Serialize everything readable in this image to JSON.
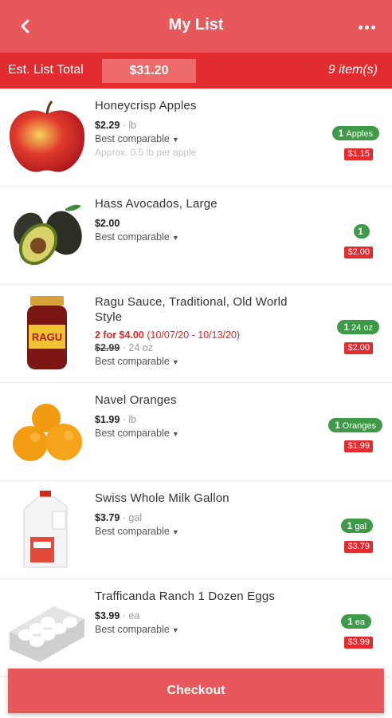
{
  "header": {
    "title": "My List"
  },
  "summary": {
    "label": "Est. List Total",
    "total": "$31.20",
    "count": "9 item(s)"
  },
  "items": [
    {
      "name": "Honeycrisp Apples",
      "price": "$2.29",
      "unit": "lb",
      "comparable": "Best comparable",
      "approx": "Approx. 0.5 lb per apple",
      "qty": "1",
      "qty_unit": "Apples",
      "line_total": "$1.15"
    },
    {
      "name": "Hass Avocados, Large",
      "price": "$2.00",
      "comparable": "Best comparable",
      "qty": "1",
      "line_total": "$2.00"
    },
    {
      "name_line1": "Ragu Sauce, Traditional, Old World",
      "name_line2": "Style",
      "sale_price": "2 for $4.00",
      "sale_dates": "(10/07/20 - 10/13/20)",
      "regular_price": "$2.99",
      "unit": "24 oz",
      "comparable": "Best comparable",
      "qty": "1",
      "qty_unit": "24 oz",
      "line_total": "$2.00"
    },
    {
      "name": "Navel Oranges",
      "price": "$1.99",
      "unit": "lb",
      "comparable": "Best comparable",
      "qty": "1",
      "qty_unit": "Oranges",
      "line_total": "$1.99"
    },
    {
      "name": "Swiss Whole Milk Gallon",
      "price": "$3.79",
      "unit": "gal",
      "comparable": "Best comparable",
      "qty": "1",
      "qty_unit": "gal",
      "line_total": "$3.79"
    },
    {
      "name": "Trafficanda Ranch 1 Dozen Eggs",
      "price": "$3.99",
      "unit": "ea",
      "comparable": "Best comparable",
      "qty": "1",
      "qty_unit": "ea",
      "line_total": "$3.99"
    }
  ],
  "footer": {
    "checkout_label": "Checkout"
  },
  "icons": {
    "back": "chevron-left-icon",
    "more": "more-horizontal-icon",
    "dropdown": "chevron-down-icon"
  },
  "colors": {
    "header": "#e8585b",
    "total_bar": "#e32c2f",
    "qty_badge": "#3f9a47",
    "sale_text": "#e0262a"
  }
}
